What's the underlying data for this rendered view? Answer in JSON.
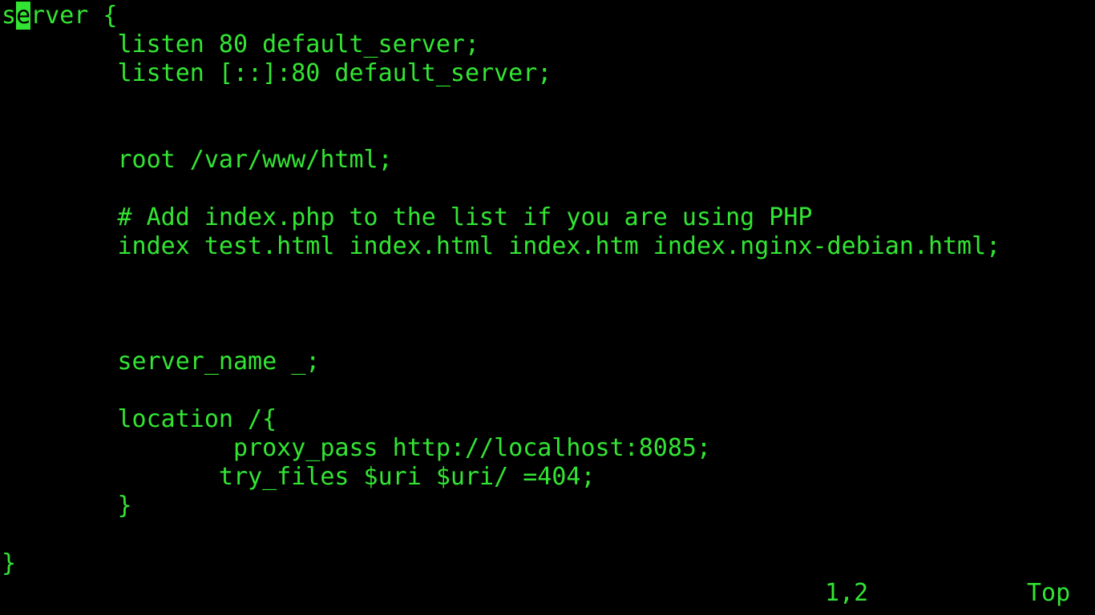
{
  "editor": {
    "colors": {
      "background": "#000000",
      "text": "#33e533",
      "cursor": "#33e533"
    },
    "cursor_line": {
      "before": "s",
      "cursor_char": "e",
      "after": "rver {"
    },
    "lines": [
      "        listen 80 default_server;",
      "        listen [::]:80 default_server;",
      "",
      "",
      "        root /var/www/html;",
      "",
      "        # Add index.php to the list if you are using PHP",
      "        index test.html index.html index.htm index.nginx-debian.html;",
      "",
      "",
      "",
      "        server_name _;",
      "",
      "        location /{",
      "                proxy_pass http://localhost:8085;",
      "               try_files $uri $uri/ =404;",
      "        }",
      "",
      "}"
    ],
    "status": {
      "position": "1,2",
      "scroll": "Top"
    }
  }
}
